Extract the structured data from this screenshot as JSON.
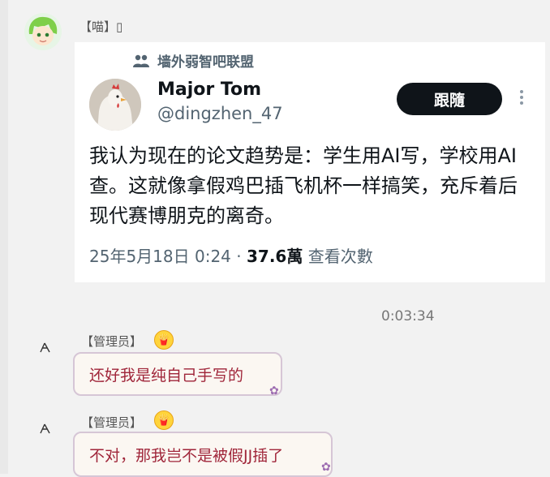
{
  "first_message": {
    "sender_tag": "【喵】",
    "sender_glyph": "▯"
  },
  "tweet": {
    "community_label": "墙外弱智吧联盟",
    "display_name": "Major Tom",
    "handle": "@dingzhen_47",
    "follow_label": "跟隨",
    "text": "我认为现在的论文趋势是：学生用AI写，学校用AI查。这就像拿假鸡巴插飞机杯一样搞笑，充斥着后现代赛博朋克的离奇。",
    "date_time": "25年5月18日 0:24",
    "separator": "·",
    "view_count": "37.6萬",
    "views_label": "查看次數"
  },
  "divider_time": "0:03:34",
  "replies": [
    {
      "sender_tag": "【管理员】",
      "text": "还好我是纯自己手写的"
    },
    {
      "sender_tag": "【管理员】",
      "text": "不对，那我岂不是被假JJ插了"
    }
  ]
}
